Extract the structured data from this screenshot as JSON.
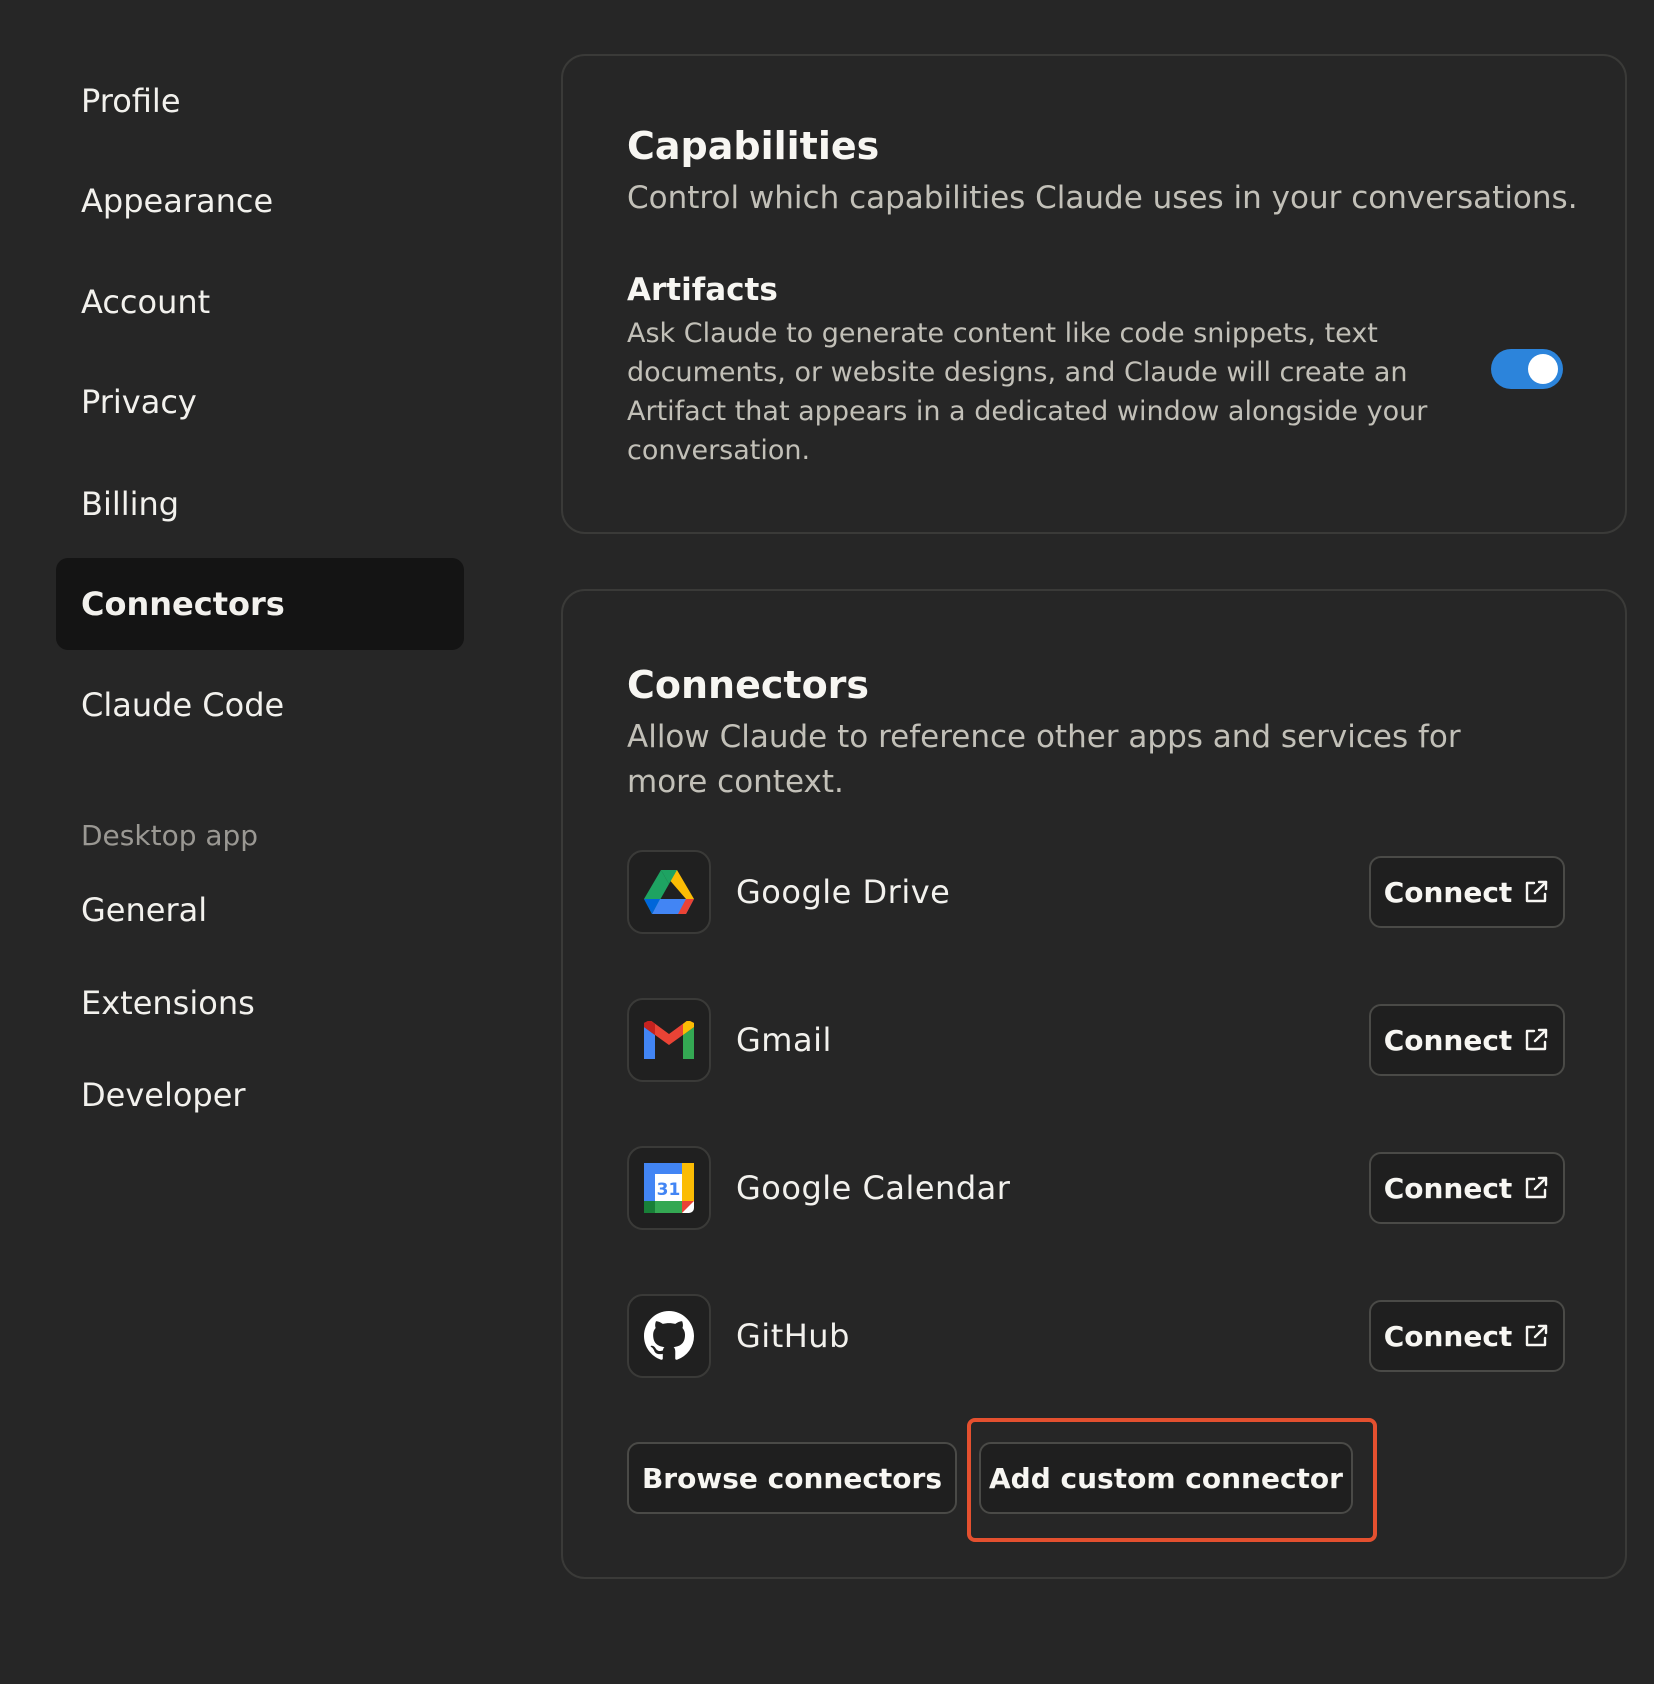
{
  "sidebar": {
    "items": [
      {
        "label": "Profile"
      },
      {
        "label": "Appearance"
      },
      {
        "label": "Account"
      },
      {
        "label": "Privacy"
      },
      {
        "label": "Billing"
      },
      {
        "label": "Connectors",
        "active": true
      },
      {
        "label": "Claude Code"
      }
    ],
    "section_label": "Desktop app",
    "desktop_items": [
      {
        "label": "General"
      },
      {
        "label": "Extensions"
      },
      {
        "label": "Developer"
      }
    ]
  },
  "capabilities": {
    "title": "Capabilities",
    "subtitle": "Control which capabilities Claude uses in your conversations.",
    "artifacts": {
      "title": "Artifacts",
      "description": "Ask Claude to generate content like code snippets, text documents, or website designs, and Claude will create an Artifact that appears in a dedicated window alongside your conversation.",
      "enabled": true
    }
  },
  "connectors": {
    "title": "Connectors",
    "subtitle": "Allow Claude to reference other apps and services for more context.",
    "items": [
      {
        "name": "Google Drive",
        "icon": "google-drive-icon",
        "button": "Connect"
      },
      {
        "name": "Gmail",
        "icon": "gmail-icon",
        "button": "Connect"
      },
      {
        "name": "Google Calendar",
        "icon": "google-calendar-icon",
        "button": "Connect"
      },
      {
        "name": "GitHub",
        "icon": "github-icon",
        "button": "Connect"
      }
    ],
    "browse_label": "Browse connectors",
    "add_custom_label": "Add custom connector",
    "calendar_day": "31"
  },
  "colors": {
    "toggle_on": "#2c84db",
    "highlight": "#e4502f",
    "active_nav_bg": "#141414"
  }
}
